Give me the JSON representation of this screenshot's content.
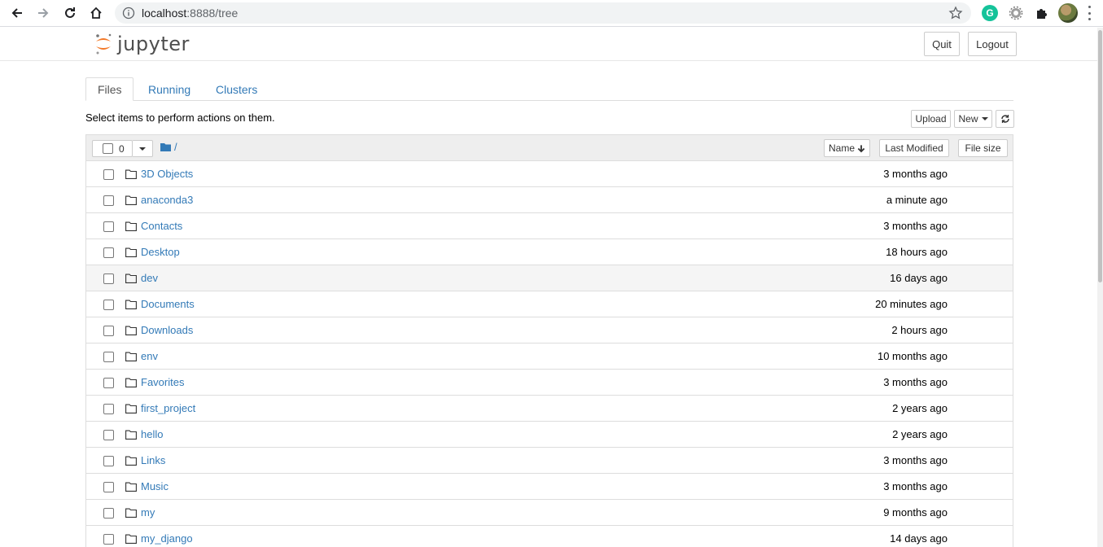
{
  "browser": {
    "url_host": "localhost",
    "url_rest": ":8888/tree",
    "grammarly_letter": "G"
  },
  "header": {
    "logo_text": "jupyter",
    "quit_label": "Quit",
    "logout_label": "Logout"
  },
  "tabs": [
    {
      "label": "Files",
      "active": true
    },
    {
      "label": "Running",
      "active": false
    },
    {
      "label": "Clusters",
      "active": false
    }
  ],
  "toolbar": {
    "hint": "Select items to perform actions on them.",
    "upload_label": "Upload",
    "new_label": "New"
  },
  "list_header": {
    "selected_count": "0",
    "breadcrumb": "/",
    "sort_name": "Name",
    "sort_modified": "Last Modified",
    "sort_size": "File size"
  },
  "files": [
    {
      "name": "3D Objects",
      "modified": "3 months ago"
    },
    {
      "name": "anaconda3",
      "modified": "a minute ago"
    },
    {
      "name": "Contacts",
      "modified": "3 months ago"
    },
    {
      "name": "Desktop",
      "modified": "18 hours ago"
    },
    {
      "name": "dev",
      "modified": "16 days ago"
    },
    {
      "name": "Documents",
      "modified": "20 minutes ago"
    },
    {
      "name": "Downloads",
      "modified": "2 hours ago"
    },
    {
      "name": "env",
      "modified": "10 months ago"
    },
    {
      "name": "Favorites",
      "modified": "3 months ago"
    },
    {
      "name": "first_project",
      "modified": "2 years ago"
    },
    {
      "name": "hello",
      "modified": "2 years ago"
    },
    {
      "name": "Links",
      "modified": "3 months ago"
    },
    {
      "name": "Music",
      "modified": "3 months ago"
    },
    {
      "name": "my",
      "modified": "9 months ago"
    },
    {
      "name": "my_django",
      "modified": "14 days ago"
    }
  ],
  "colors": {
    "link": "#337ab7",
    "jupyter_orange": "#f37726"
  }
}
